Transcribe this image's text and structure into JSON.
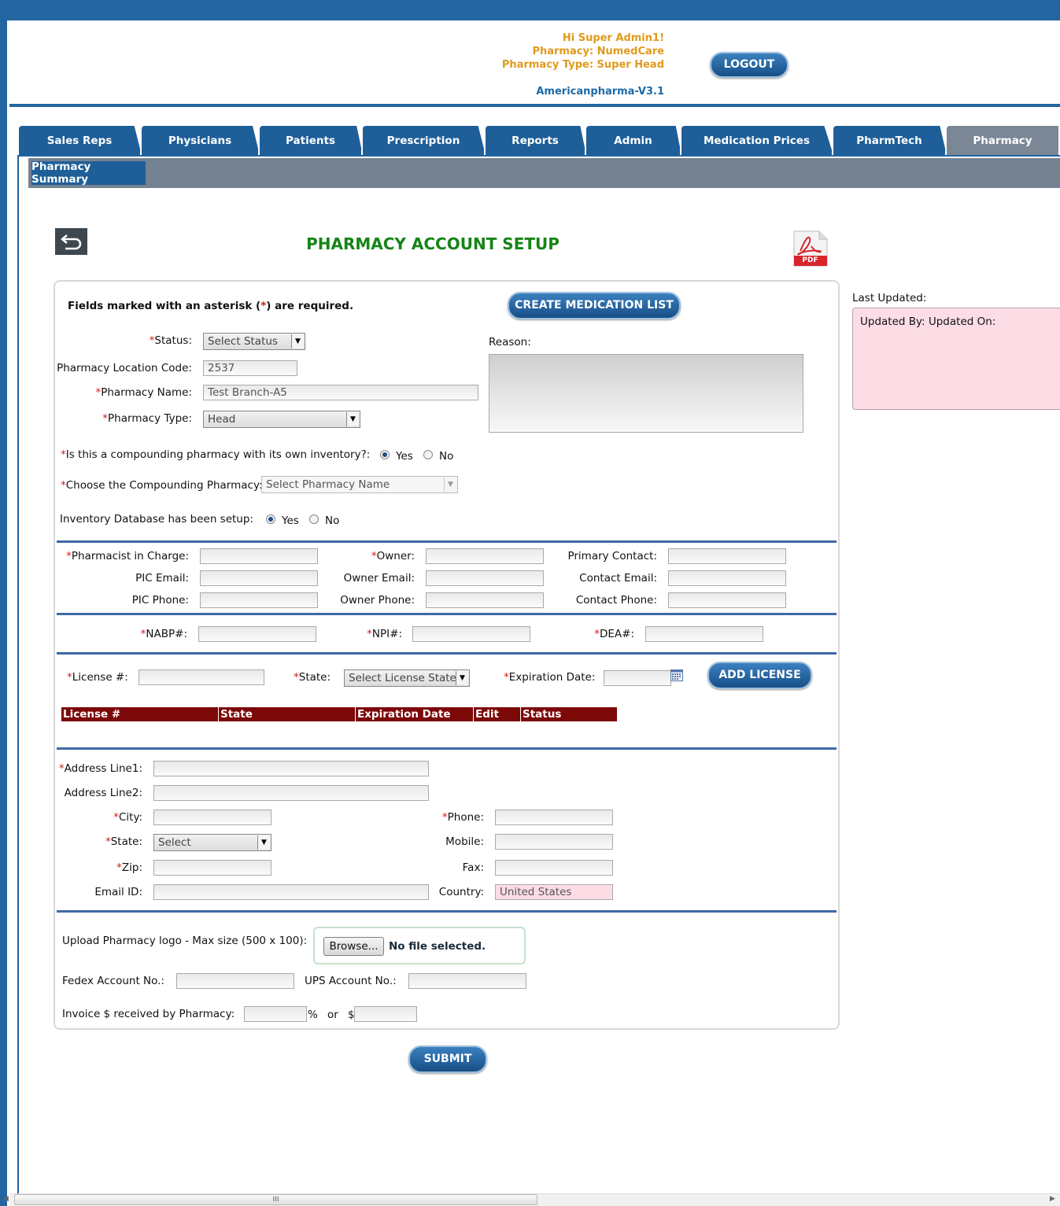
{
  "header": {
    "greeting": "Hi Super Admin1!",
    "pharmacy": "Pharmacy: NumedCare",
    "pharmacy_type": "Pharmacy Type: Super Head",
    "version": "Americanpharma-V3.1",
    "logout_label": "LOGOUT"
  },
  "nav": {
    "tabs": [
      "Sales Reps",
      "Physicians",
      "Patients",
      "Prescription",
      "Reports",
      "Admin",
      "Medication Prices",
      "PharmTech",
      "Pharmacy"
    ],
    "active": "Pharmacy",
    "subtab": "Pharmacy Summary"
  },
  "page": {
    "title": "PHARMACY ACCOUNT SETUP",
    "pdf_label": "PDF",
    "required_note_prefix": "Fields marked with an asterisk (",
    "required_note_star": "*",
    "required_note_suffix": ") are required.",
    "create_med_list_label": "CREATE MEDICATION LIST",
    "submit_label": "SUBMIT"
  },
  "form": {
    "status_label": "Status:",
    "status_value": "Select Status",
    "location_code_label": "Pharmacy Location Code:",
    "location_code_value": "2537",
    "pharmacy_name_label": "Pharmacy Name:",
    "pharmacy_name_value": "Test Branch-A5",
    "pharmacy_type_label": "Pharmacy Type:",
    "pharmacy_type_value": "Head",
    "reason_label": "Reason:",
    "compounding_question": "Is this a compounding pharmacy with its own inventory?:",
    "compounding_yes": "Yes",
    "compounding_no": "No",
    "choose_compounding_label": "Choose the Compounding Pharmacy:",
    "choose_compounding_value": "Select Pharmacy Name",
    "inventory_label": "Inventory Database has been setup:",
    "inventory_yes": "Yes",
    "inventory_no": "No",
    "pic_label": "Pharmacist in Charge:",
    "pic_email_label": "PIC Email:",
    "pic_phone_label": "PIC Phone:",
    "owner_label": "Owner:",
    "owner_email_label": "Owner Email:",
    "owner_phone_label": "Owner Phone:",
    "primary_contact_label": "Primary Contact:",
    "contact_email_label": "Contact Email:",
    "contact_phone_label": "Contact Phone:",
    "nabp_label": "NABP#:",
    "npi_label": "NPI#:",
    "dea_label": "DEA#:",
    "license_label": "License #:",
    "license_state_label": "State:",
    "license_state_value": "Select License State",
    "expiration_label": "Expiration Date:",
    "add_license_label": "ADD LICENSE",
    "license_table_headers": [
      "License #",
      "State",
      "Expiration Date",
      "Edit",
      "Status"
    ],
    "address1_label": "Address Line1:",
    "address2_label": "Address Line2:",
    "city_label": "City:",
    "state_label": "State:",
    "state_value": "Select",
    "zip_label": "Zip:",
    "email_label": "Email ID:",
    "phone_label": "Phone:",
    "mobile_label": "Mobile:",
    "fax_label": "Fax:",
    "country_label": "Country:",
    "country_value": "United States",
    "upload_logo_label": "Upload Pharmacy logo - Max size (500 x 100):",
    "browse_label": "Browse...",
    "no_file_label": "No file selected.",
    "fedex_label": "Fedex Account No.:",
    "ups_label": "UPS Account No.:",
    "invoice_label": "Invoice $ received by Pharmacy:",
    "percent_sign": "%",
    "or_label": "or",
    "dollar_sign": "$"
  },
  "sidebar": {
    "last_updated_label": "Last Updated:",
    "updated_by_text": "Updated By: Updated On:"
  },
  "scrollbar": {
    "grip": "III"
  }
}
